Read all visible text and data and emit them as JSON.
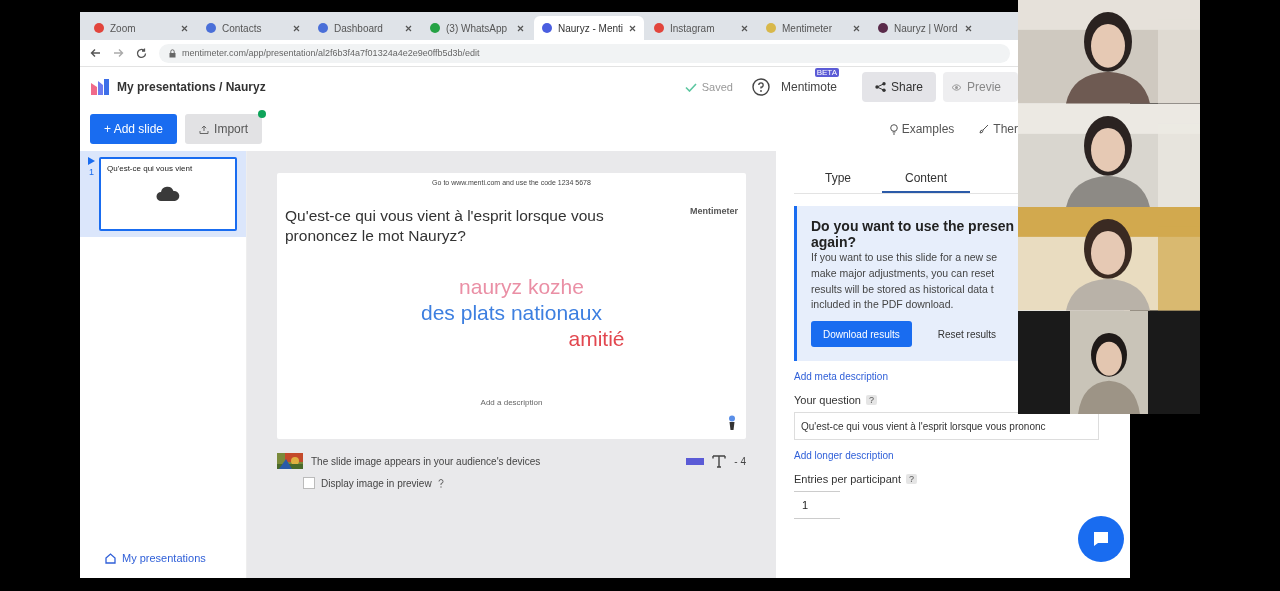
{
  "browser": {
    "tabs": [
      {
        "label": "Zoom",
        "color": "#e2453c",
        "selected": false
      },
      {
        "label": "Contacts",
        "color": "#4a6fd8",
        "selected": false
      },
      {
        "label": "Dashboard",
        "color": "#4a6fd8",
        "selected": false
      },
      {
        "label": "(3) WhatsApp",
        "color": "#25a244",
        "selected": false
      },
      {
        "label": "Nauryz - Menti",
        "color": "#4a5ee0",
        "selected": true
      },
      {
        "label": "Instagram",
        "color": "#e2453c",
        "selected": false
      },
      {
        "label": "Mentimeter",
        "color": "#d8b84a",
        "selected": false
      },
      {
        "label": "Nauryz | Word",
        "color": "#5a2a4a",
        "selected": false
      }
    ],
    "url": "mentimeter.com/app/presentation/al2f6b3f4a7f01324a4e2e9e0ffb5d3b/edit"
  },
  "header": {
    "breadcrumb": "My presentations / Nauryz",
    "saved": "Saved",
    "mentimote": "Mentimote",
    "beta": "BETA",
    "share": "Share",
    "preview": "Previe"
  },
  "toolbar": {
    "add_slide": "+ Add slide",
    "import": "Import",
    "examples": "Examples",
    "themes": "Ther"
  },
  "sidebar": {
    "slides": [
      {
        "number": "1",
        "title": "Qu'est-ce qui vous vient",
        "selected": true
      }
    ],
    "footer_link": "My presentations"
  },
  "slide": {
    "code_line": "Go to www.menti.com and use the code 1234 5678",
    "question": "Qu'est-ce qui vous vient à l'esprit lorsque vous prononcez le mot Nauryz?",
    "brand": "Mentimeter",
    "words": [
      {
        "text": "nauryz kozhe",
        "color": "#ea8fa5"
      },
      {
        "text": "des plats nationaux",
        "color": "#3d7fe0"
      },
      {
        "text": "amitié",
        "color": "#e2474f"
      }
    ],
    "footer": "Add a description"
  },
  "image_row": {
    "caption": "The slide image appears in your audience's devices",
    "count": "- 4",
    "display_in_preview": {
      "label": "Display image in preview",
      "checked": false
    }
  },
  "panel": {
    "tabs": [
      {
        "label": "Type",
        "selected": false
      },
      {
        "label": "Content",
        "selected": true
      }
    ],
    "notice": {
      "title_lines": [
        "Do you want to use the presen",
        "again?"
      ],
      "body_lines": [
        "If you want to use this slide for a new se",
        "make major adjustments, you can reset",
        "results will be stored as historical data t",
        "included in the PDF download."
      ],
      "download": "Download results",
      "reset": "Reset results"
    },
    "meta_link": "Add meta description",
    "question_label": "Your question",
    "question_help": "?",
    "question_value": "Qu'est-ce qui vous vient à l'esprit lorsque vous prononc",
    "longer_link": "Add longer description",
    "entries_label": "Entries per participant",
    "entries_help": "?",
    "entries_value": "1"
  }
}
